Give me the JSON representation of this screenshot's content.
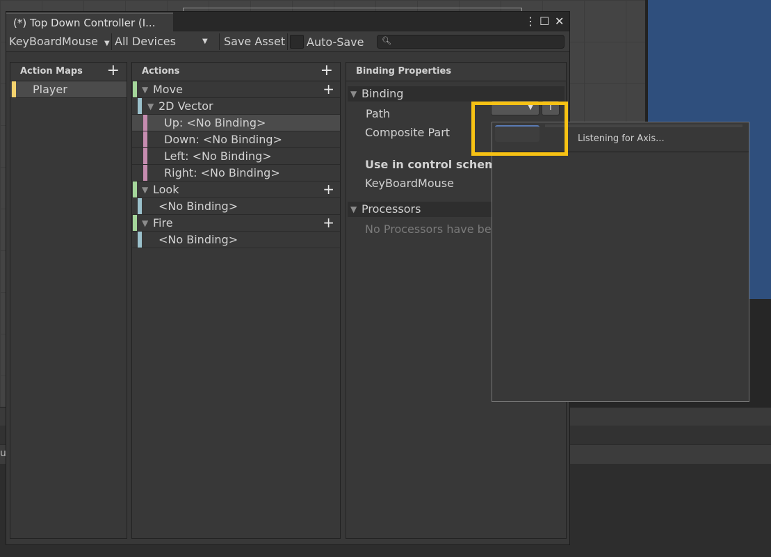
{
  "window": {
    "title": "(*) Top Down Controller (I...",
    "menu_icon": "⋮",
    "maximize_icon": "☐",
    "close_icon": "✕"
  },
  "toolbar": {
    "control_scheme": "KeyBoardMouse",
    "devices": "All Devices",
    "save_asset": "Save Asset",
    "auto_save": "Auto-Save",
    "search_placeholder": ""
  },
  "action_maps": {
    "header": "Action Maps",
    "add_icon": "+",
    "items": [
      {
        "label": "Player"
      }
    ]
  },
  "actions": {
    "header": "Actions",
    "add_icon": "+",
    "rows": [
      {
        "label": "Move"
      },
      {
        "label": "2D Vector"
      },
      {
        "label": "Up: <No Binding>"
      },
      {
        "label": "Down: <No Binding>"
      },
      {
        "label": "Left: <No Binding>"
      },
      {
        "label": "Right: <No Binding>"
      },
      {
        "label": "Look"
      },
      {
        "label": "<No Binding>"
      },
      {
        "label": "Fire"
      },
      {
        "label": "<No Binding>"
      }
    ]
  },
  "binding_properties": {
    "header": "Binding Properties",
    "binding_section": "Binding",
    "path_label": "Path",
    "composite_part_label": "Composite Part",
    "control_scheme_heading": "Use in control scheme",
    "control_scheme_value": "KeyBoardMouse",
    "processors_section": "Processors",
    "processors_empty": "No Processors have bee"
  },
  "popup": {
    "listening_text": "Listening for Axis..."
  },
  "colors": {
    "action_map_bar": "#f5d36e",
    "action_bar": "#a4d69a",
    "composite_bar": "#9bc1cc",
    "part_bar": "#c68cb0",
    "highlight": "#f7c214"
  }
}
